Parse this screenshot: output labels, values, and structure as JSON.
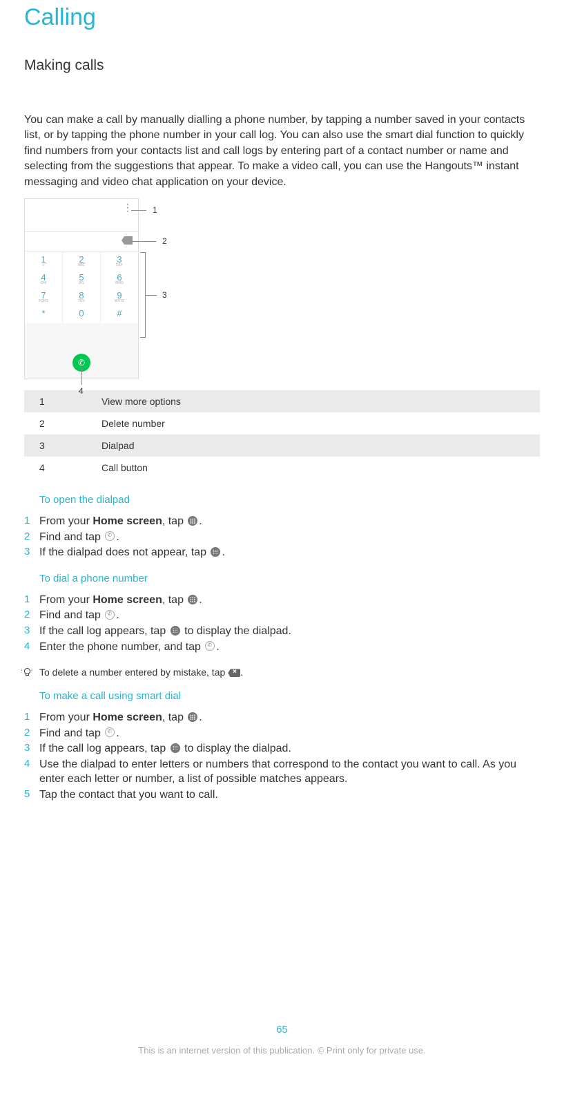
{
  "title": "Calling",
  "section": "Making calls",
  "intro": "You can make a call by manually dialling a phone number, by tapping a number saved in your contacts list, or by tapping the phone number in your call log. You can also use the smart dial function to quickly find numbers from your contacts list and call logs by entering part of a contact number or name and selecting from the suggestions that appear. To make a video call, you can use the Hangouts™ instant messaging and video chat application on your device.",
  "figure": {
    "callouts": {
      "c1": "1",
      "c2": "2",
      "c3": "3",
      "c4": "4"
    },
    "keys": {
      "r1": [
        {
          "n": "1",
          "s": "∞"
        },
        {
          "n": "2",
          "s": "ABC"
        },
        {
          "n": "3",
          "s": "DEF"
        }
      ],
      "r2": [
        {
          "n": "4",
          "s": "GHI"
        },
        {
          "n": "5",
          "s": "JKL"
        },
        {
          "n": "6",
          "s": "MNO"
        }
      ],
      "r3": [
        {
          "n": "7",
          "s": "PQRS"
        },
        {
          "n": "8",
          "s": "TUV"
        },
        {
          "n": "9",
          "s": "WXYZ"
        }
      ],
      "r4": [
        {
          "n": "*",
          "s": ""
        },
        {
          "n": "0",
          "s": "+"
        },
        {
          "n": "#",
          "s": ""
        }
      ]
    }
  },
  "legend": [
    {
      "n": "1",
      "t": "View more options"
    },
    {
      "n": "2",
      "t": "Delete number"
    },
    {
      "n": "3",
      "t": "Dialpad"
    },
    {
      "n": "4",
      "t": "Call button"
    }
  ],
  "sub1": "To open the dialpad",
  "steps1": [
    {
      "n": "1",
      "p": "From your ",
      "b": "Home screen",
      "r": ", tap ",
      "icon": "apps",
      "tail": "."
    },
    {
      "n": "2",
      "p": "Find and tap ",
      "icon": "phone",
      "tail": "."
    },
    {
      "n": "3",
      "p": "If the dialpad does not appear, tap ",
      "icon": "dial",
      "tail": "."
    }
  ],
  "sub2": "To dial a phone number",
  "steps2": [
    {
      "n": "1",
      "p": "From your ",
      "b": "Home screen",
      "r": ", tap ",
      "icon": "apps",
      "tail": "."
    },
    {
      "n": "2",
      "p": "Find and tap ",
      "icon": "phone",
      "tail": "."
    },
    {
      "n": "3",
      "p": "If the call log appears, tap ",
      "icon": "dial",
      "tail": " to display the dialpad."
    },
    {
      "n": "4",
      "p": "Enter the phone number, and tap ",
      "icon": "call",
      "tail": "."
    }
  ],
  "tip": {
    "pre": "To delete a number entered by mistake, tap ",
    "tail": "."
  },
  "sub3": "To make a call using smart dial",
  "steps3": [
    {
      "n": "1",
      "p": "From your ",
      "b": "Home screen",
      "r": ", tap ",
      "icon": "apps",
      "tail": "."
    },
    {
      "n": "2",
      "p": "Find and tap ",
      "icon": "phone",
      "tail": "."
    },
    {
      "n": "3",
      "p": "If the call log appears, tap ",
      "icon": "dial",
      "tail": " to display the dialpad."
    },
    {
      "n": "4",
      "p": "Use the dialpad to enter letters or numbers that correspond to the contact you want to call. As you enter each letter or number, a list of possible matches appears."
    },
    {
      "n": "5",
      "p": "Tap the contact that you want to call."
    }
  ],
  "page_num": "65",
  "notice": "This is an internet version of this publication. © Print only for private use."
}
